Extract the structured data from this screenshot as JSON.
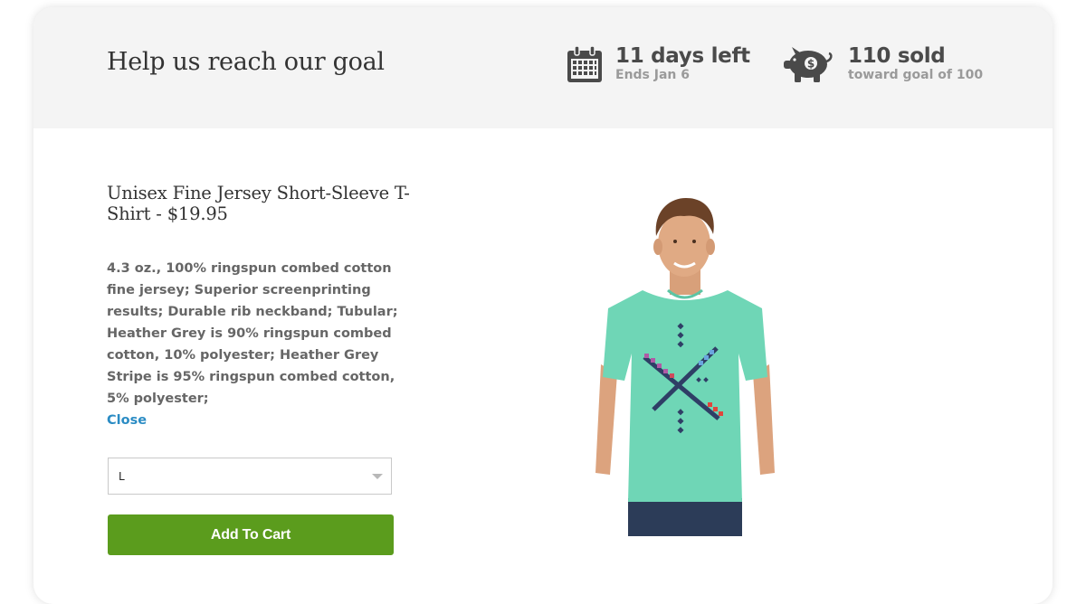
{
  "goal_bar": {
    "title": "Help us reach our goal",
    "days": {
      "main": "11 days left",
      "sub": "Ends Jan 6",
      "icon": "calendar-icon"
    },
    "sold": {
      "main": "110 sold",
      "sub": "toward goal of 100",
      "icon": "piggy-bank-icon"
    }
  },
  "product": {
    "title": "Unisex Fine Jersey Short-Sleeve T-Shirt - $19.95",
    "description": "4.3 oz., 100% ringspun combed cotton fine jersey; Superior screenprinting results; Durable rib neckband; Tubular; Heather Grey is 90% ringspun combed cotton, 10% polyester; Heather Grey Stripe is 95% ringspun combed cotton, 5% polyester;",
    "close_label": "Close",
    "size_selected": "L",
    "add_to_cart_label": "Add To Cart",
    "shirt_color": "#6fd6b6",
    "button_color": "#5b9c1d"
  }
}
